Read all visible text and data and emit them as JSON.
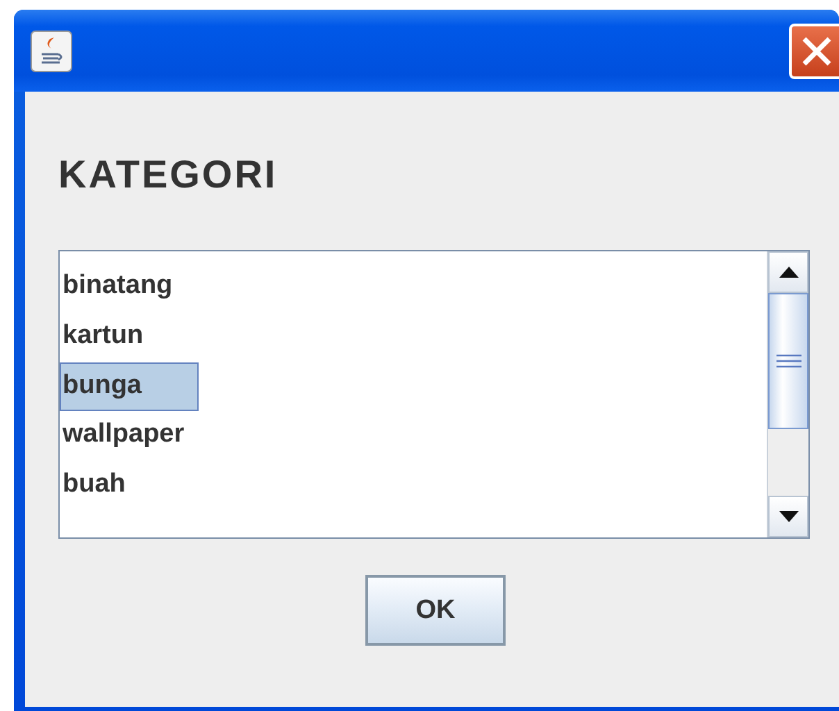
{
  "heading": "KATEGORI",
  "list": {
    "items": [
      {
        "label": "binatang",
        "selected": false
      },
      {
        "label": "kartun",
        "selected": false
      },
      {
        "label": "bunga",
        "selected": true
      },
      {
        "label": "wallpaper",
        "selected": false
      },
      {
        "label": "buah",
        "selected": false
      }
    ]
  },
  "buttons": [
    "OK"
  ]
}
